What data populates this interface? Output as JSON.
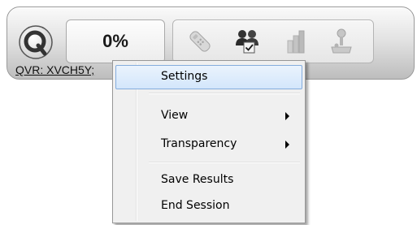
{
  "toolbar": {
    "progress_text": "0%",
    "session_label": "QVR: XVCH5Y;",
    "icons": [
      "q-logo-icon",
      "remote-control-icon",
      "users-checklist-icon",
      "bar-chart-icon",
      "joystick-icon"
    ]
  },
  "context_menu": {
    "items": [
      {
        "label": "Settings",
        "highlighted": true
      },
      {
        "label": "View",
        "submenu": true
      },
      {
        "label": "Transparency",
        "submenu": true
      },
      {
        "label": "Save Results"
      },
      {
        "label": "End Session"
      }
    ]
  },
  "colors": {
    "highlight_border": "#84acdd",
    "highlight_fill": "#d3e6fb",
    "menu_background": "#f0f0f0"
  }
}
